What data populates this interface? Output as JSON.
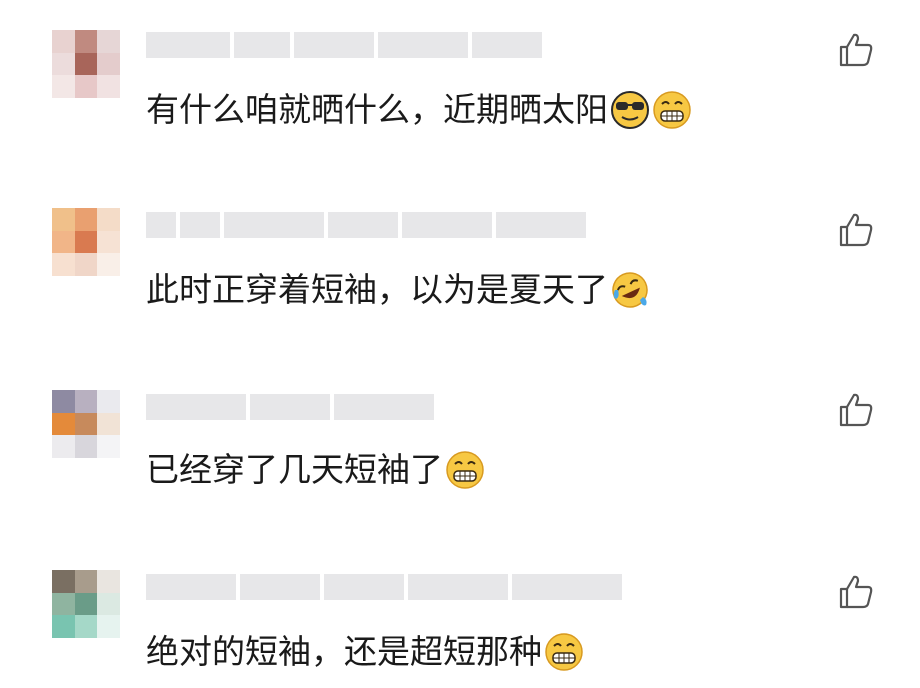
{
  "comments": [
    {
      "text": "有什么咱就晒什么，近期晒太阳",
      "emojis": [
        "cool-sunglasses-emoji",
        "grin-emoji"
      ],
      "avatar_colors": [
        "#e8d2d0",
        "#c08a80",
        "#e6d6d6",
        "#ecdcdc",
        "#a8655a",
        "#e4cccc",
        "#f3e7e6",
        "#e7c8c8",
        "#f1e2e2"
      ],
      "like_icon": "thumbs-up-icon"
    },
    {
      "text": "此时正穿着短袖，以为是夏天了",
      "emojis": [
        "laugh-cry-emoji"
      ],
      "avatar_colors": [
        "#f0c08a",
        "#e9a070",
        "#f4dcc8",
        "#f1b588",
        "#d97a50",
        "#f6e2d4",
        "#f7e0d0",
        "#f0d6c8",
        "#f9efe8"
      ],
      "like_icon": "thumbs-up-icon"
    },
    {
      "text": "已经穿了几天短袖了",
      "emojis": [
        "grin-emoji"
      ],
      "avatar_colors": [
        "#8e8aa2",
        "#b8b0c0",
        "#eaeaee",
        "#e48a3a",
        "#c78a5c",
        "#f1e3d6",
        "#ecebee",
        "#d8d6dc",
        "#f4f4f6"
      ],
      "like_icon": "thumbs-up-icon"
    },
    {
      "text": "绝对的短袖，还是超短那种",
      "emojis": [
        "grin-emoji"
      ],
      "avatar_colors": [
        "#7a6f62",
        "#a89c8c",
        "#e9e5e0",
        "#8fb4a0",
        "#6a9c88",
        "#dbe9e2",
        "#79c4b0",
        "#a5d8c8",
        "#e6f3ef"
      ],
      "like_icon": "thumbs-up-icon"
    }
  ]
}
